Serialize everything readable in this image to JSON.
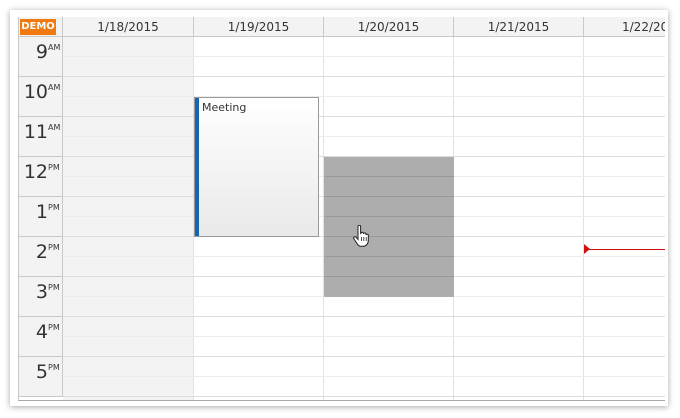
{
  "corner": {
    "badge": "DEMO"
  },
  "days": [
    {
      "label": "1/18/2015"
    },
    {
      "label": "1/19/2015"
    },
    {
      "label": "1/20/2015"
    },
    {
      "label": "1/21/2015"
    },
    {
      "label": "1/22/20"
    }
  ],
  "hours": [
    {
      "num": "9",
      "ampm": "AM"
    },
    {
      "num": "10",
      "ampm": "AM"
    },
    {
      "num": "11",
      "ampm": "AM"
    },
    {
      "num": "12",
      "ampm": "PM"
    },
    {
      "num": "1",
      "ampm": "PM"
    },
    {
      "num": "2",
      "ampm": "PM"
    },
    {
      "num": "3",
      "ampm": "PM"
    },
    {
      "num": "4",
      "ampm": "PM"
    },
    {
      "num": "5",
      "ampm": "PM"
    }
  ],
  "event": {
    "text": "Meeting",
    "bar_color": "#1565b0"
  },
  "colors": {
    "demo_badge": "#f07a10",
    "selection": "#adadad",
    "current_time": "#d01010",
    "header_bg": "#f3f3f3"
  },
  "icons": {
    "cursor": "hand-pointer-icon",
    "time_marker": "current-time-arrow-icon"
  }
}
